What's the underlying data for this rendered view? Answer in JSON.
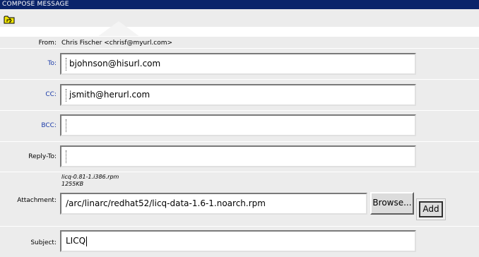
{
  "window": {
    "title": "COMPOSE MESSAGE"
  },
  "toolbar": {
    "back_icon": "folder-up-icon"
  },
  "from": {
    "label": "From:",
    "value": "Chris Fischer <chrisf@myurl.com>"
  },
  "to": {
    "label": "To:",
    "value": "bjohnson@hisurl.com"
  },
  "cc": {
    "label": "CC:",
    "value": "jsmith@herurl.com"
  },
  "bcc": {
    "label": "BCC:",
    "value": ""
  },
  "reply_to": {
    "label": "Reply-To:",
    "value": ""
  },
  "attachment": {
    "label": "Attachment:",
    "file_name": "licq-0.81-1.i386.rpm",
    "file_size": "1255KB",
    "path": "/arc/linarc/redhat52/licq-data-1.6-1.noarch.rpm",
    "browse_label": "Browse...",
    "add_label": "Add"
  },
  "subject": {
    "label": "Subject:",
    "value": "LICQ"
  },
  "colors": {
    "titlebar": "#0a246a",
    "row_bg": "#ececec",
    "link_label": "#1a3aa8"
  }
}
